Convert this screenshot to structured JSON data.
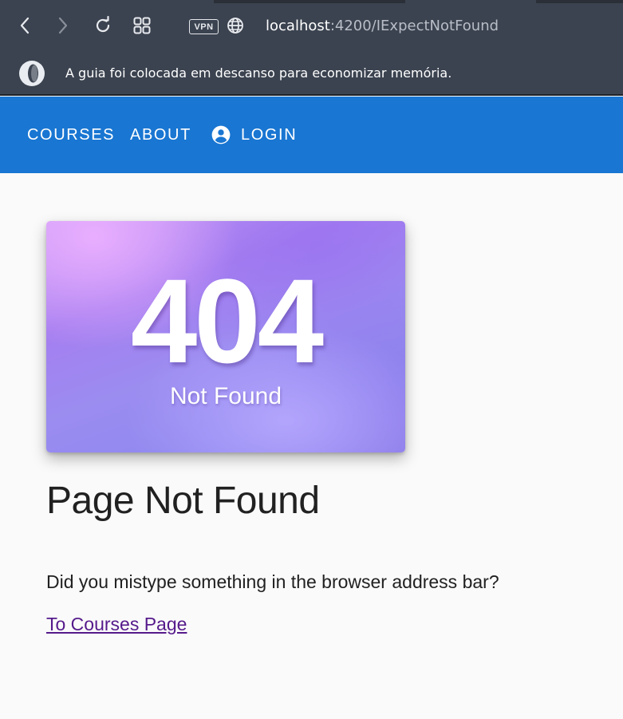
{
  "browser": {
    "url_host": "localhost",
    "url_path": ":4200/IExpectNotFound",
    "vpn_label": "VPN",
    "icons": {
      "back": "chevron-left-icon",
      "forward": "chevron-right-icon",
      "reload": "reload-icon",
      "tabs": "tab-grid-icon",
      "site_info": "globe-icon",
      "browser_logo": "opera-logo-icon"
    },
    "notice": "A guia foi colocada em descanso para economizar memória."
  },
  "toolbar": {
    "items": [
      {
        "label": "COURSES"
      },
      {
        "label": "ABOUT"
      },
      {
        "label": "LOGIN",
        "icon": "account-circle-icon"
      }
    ],
    "color": "#1976d2"
  },
  "main": {
    "hero_code": "404",
    "hero_subtitle": "Not Found",
    "title": "Page Not Found",
    "message": "Did you mistype something in the browser address bar?",
    "link_label": "To Courses Page",
    "link_color": "#551a8b"
  }
}
